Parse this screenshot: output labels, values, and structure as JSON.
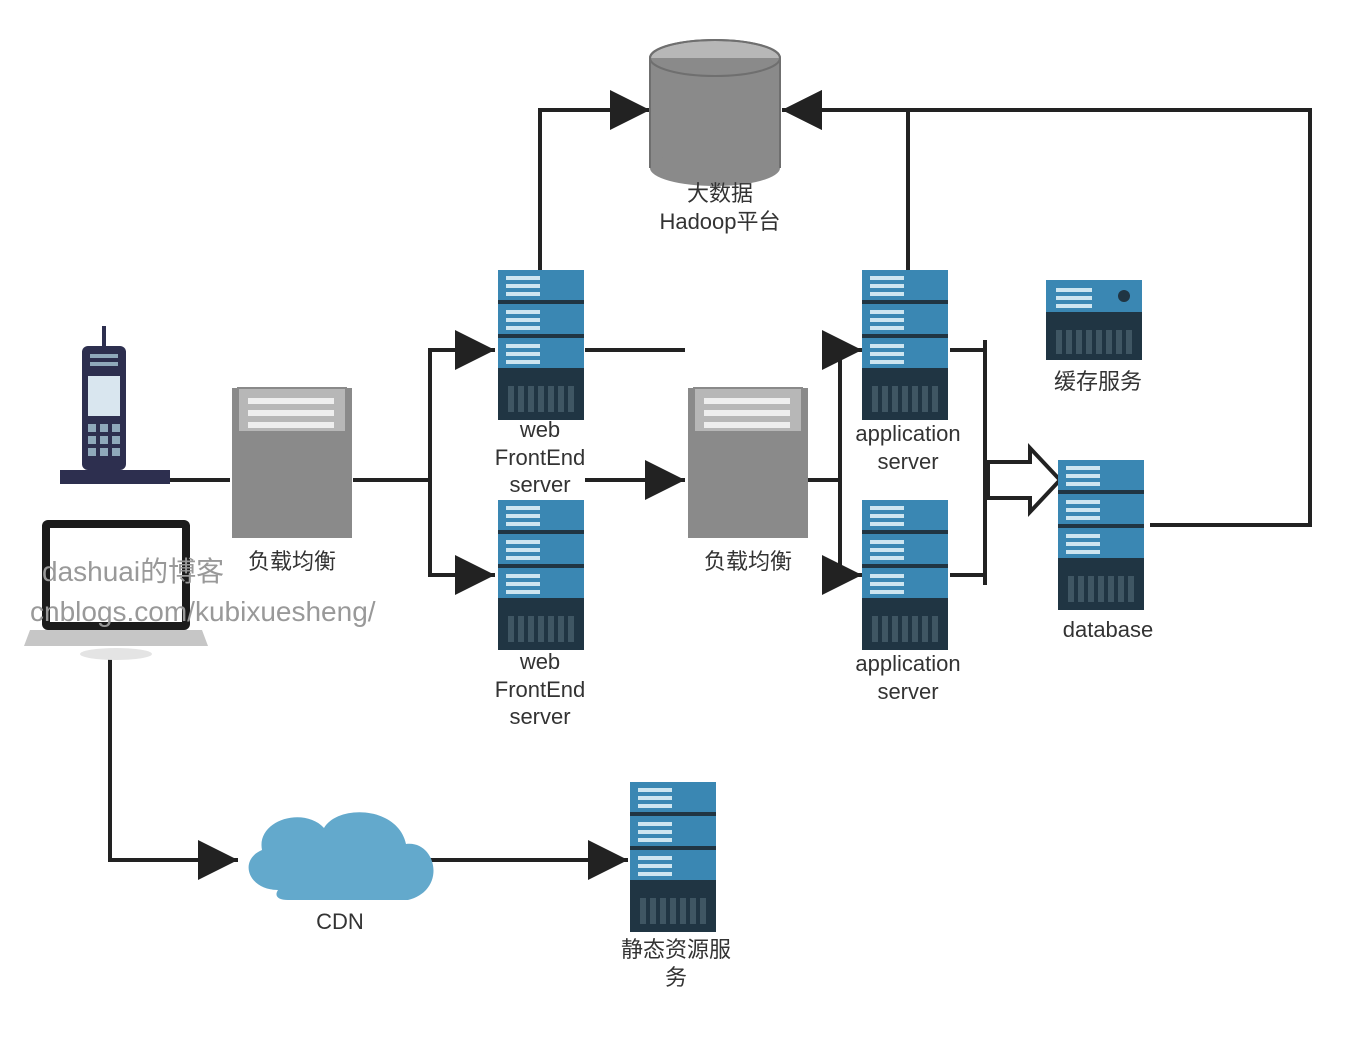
{
  "labels": {
    "loadBalancer1": "负载均衡",
    "loadBalancer2": "负载均衡",
    "webFrontendServer1": "web\nFrontEnd\nserver",
    "webFrontendServer2": "web\nFrontEnd\nserver",
    "applicationServer1": "application\nserver",
    "applicationServer2": "application\nserver",
    "cacheService": "缓存服务",
    "database": "database",
    "hadoop": "大数据\nHadoop平台",
    "cdn": "CDN",
    "staticResourceService": "静态资源服\n务"
  },
  "watermark": {
    "line1": "dashuai的博客",
    "line2": "cnblogs.com/kubixuesheng/"
  },
  "colors": {
    "serverDark": "#203543",
    "serverBlue": "#3a87b3",
    "boxGray": "#8a8a8a",
    "boxGrayLight": "#b7b7b7",
    "cdnBlue": "#63a9cc",
    "line": "#222222",
    "phoneDark": "#2d2f4f"
  }
}
